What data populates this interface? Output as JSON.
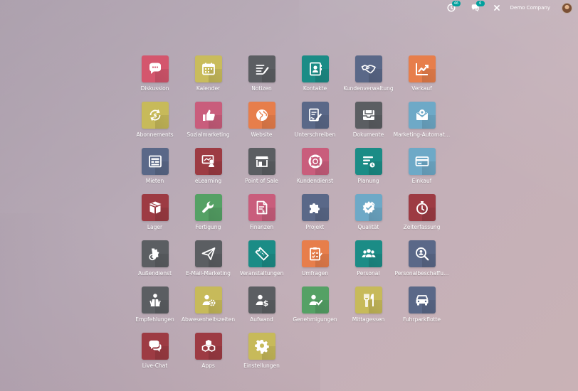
{
  "topbar": {
    "activity_count": "46",
    "message_count": "6",
    "company": "Demo Company"
  },
  "colors": {
    "red": "#d4566d",
    "olive": "#c7ba5a",
    "charcoal": "#5b5e62",
    "teal": "#1b8c86",
    "slate": "#5a6888",
    "orange": "#e77e4b",
    "lightblue": "#6ea9c7",
    "pink": "#c95d7c",
    "maroon": "#9d3b43",
    "green": "#55a165"
  },
  "apps": [
    {
      "label": "Diskussion",
      "color": "#d4566d",
      "icon": "chat-bubble-icon"
    },
    {
      "label": "Kalender",
      "color": "#c9bc5c",
      "icon": "calendar-icon"
    },
    {
      "label": "Notizen",
      "color": "#5b5e62",
      "icon": "notes-icon"
    },
    {
      "label": "Kontakte",
      "color": "#1b8c86",
      "icon": "address-book-icon"
    },
    {
      "label": "Kundenverwaltung",
      "color": "#5a6888",
      "icon": "handshake-icon"
    },
    {
      "label": "Verkauf",
      "color": "#e77e4b",
      "icon": "chart-line-icon"
    },
    {
      "label": "Abonnements",
      "color": "#c7ba5a",
      "icon": "refresh-dollar-icon"
    },
    {
      "label": "Sozialmarketing",
      "color": "#c95d7c",
      "icon": "thumbs-up-icon"
    },
    {
      "label": "Website",
      "color": "#e77e4b",
      "icon": "globe-icon"
    },
    {
      "label": "Unterschreiben",
      "color": "#5a6888",
      "icon": "signature-icon"
    },
    {
      "label": "Dokumente",
      "color": "#5b5e62",
      "icon": "inbox-icon"
    },
    {
      "label": "Marketing-Automat…",
      "color": "#6ea9c7",
      "icon": "gear-mail-icon"
    },
    {
      "label": "Mieten",
      "color": "#5a6888",
      "icon": "rental-icon"
    },
    {
      "label": "eLearning",
      "color": "#9d3b43",
      "icon": "teacher-icon"
    },
    {
      "label": "Point of Sale",
      "color": "#5b5e62",
      "icon": "shop-icon"
    },
    {
      "label": "Kundendienst",
      "color": "#c95d7c",
      "icon": "lifebuoy-icon"
    },
    {
      "label": "Planung",
      "color": "#1b8c86",
      "icon": "planning-icon"
    },
    {
      "label": "Einkauf",
      "color": "#6ea9c7",
      "icon": "credit-card-icon"
    },
    {
      "label": "Lager",
      "color": "#9d3b43",
      "icon": "box-icon"
    },
    {
      "label": "Fertigung",
      "color": "#55a165",
      "icon": "wrench-icon"
    },
    {
      "label": "Finanzen",
      "color": "#c95d7c",
      "icon": "invoice-icon"
    },
    {
      "label": "Projekt",
      "color": "#5a6888",
      "icon": "puzzle-icon"
    },
    {
      "label": "Qualität",
      "color": "#6ea9c7",
      "icon": "quality-badge-icon"
    },
    {
      "label": "Zeiterfassung",
      "color": "#9d3b43",
      "icon": "stopwatch-icon"
    },
    {
      "label": "Außendienst",
      "color": "#5b5e62",
      "icon": "field-service-icon"
    },
    {
      "label": "E-Mail-Marketing",
      "color": "#5b5e62",
      "icon": "paper-plane-icon"
    },
    {
      "label": "Veranstaltungen",
      "color": "#1b8c86",
      "icon": "ticket-icon"
    },
    {
      "label": "Umfragen",
      "color": "#e77e4b",
      "icon": "survey-icon"
    },
    {
      "label": "Personal",
      "color": "#1b8c86",
      "icon": "people-icon"
    },
    {
      "label": "Personalbeschaffu…",
      "color": "#5a6888",
      "icon": "search-person-icon"
    },
    {
      "label": "Empfehlungen",
      "color": "#5b5e62",
      "icon": "referral-icon"
    },
    {
      "label": "Abwesenheitszeiten",
      "color": "#c7ba5a",
      "icon": "user-gear-icon"
    },
    {
      "label": "Aufwand",
      "color": "#5b5e62",
      "icon": "user-dollar-icon"
    },
    {
      "label": "Genehmigungen",
      "color": "#55a165",
      "icon": "user-check-icon"
    },
    {
      "label": "Mittagessen",
      "color": "#c7ba5a",
      "icon": "cutlery-icon"
    },
    {
      "label": "Fuhrparkflotte",
      "color": "#5a6888",
      "icon": "car-icon"
    },
    {
      "label": "Live-Chat",
      "color": "#9d3b43",
      "icon": "chat-bubbles-icon"
    },
    {
      "label": "Apps",
      "color": "#9d3b43",
      "icon": "cubes-icon"
    },
    {
      "label": "Einstellungen",
      "color": "#c7ba5a",
      "icon": "settings-gear-icon"
    }
  ]
}
